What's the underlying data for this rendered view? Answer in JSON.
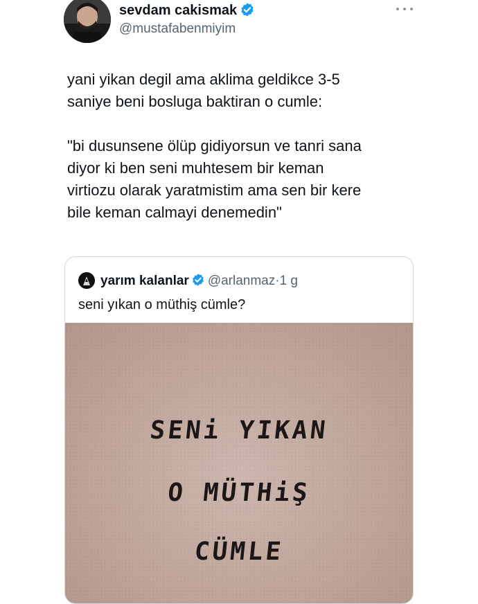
{
  "tweet": {
    "author": {
      "name": "sevdam cakismak",
      "handle": "@mustafabenmiyim",
      "verified_color": "#1d9bf0"
    },
    "more_icon": "more-horizontal-icon",
    "text": "yani yikan degil ama aklima geldikce 3-5\nsaniye beni bosluga baktiran o cumle:\n\n\"bi dusunsene ölüp gidiyorsun ve tanri sana\ndiyor ki ben seni muhtesem bir keman\nvirtiozu olarak yaratmistim ama sen bir kere\nbile keman calmayi denemedin\""
  },
  "quote": {
    "author": {
      "name": "yarım kalanlar",
      "handle": "@arlanmaz",
      "separator": "·",
      "time": "1 g"
    },
    "text": "seni yıkan o müthiş cümle?",
    "image_lines": [
      "SENi YIKAN",
      "O MÜTHiŞ",
      "CÜMLE"
    ]
  }
}
